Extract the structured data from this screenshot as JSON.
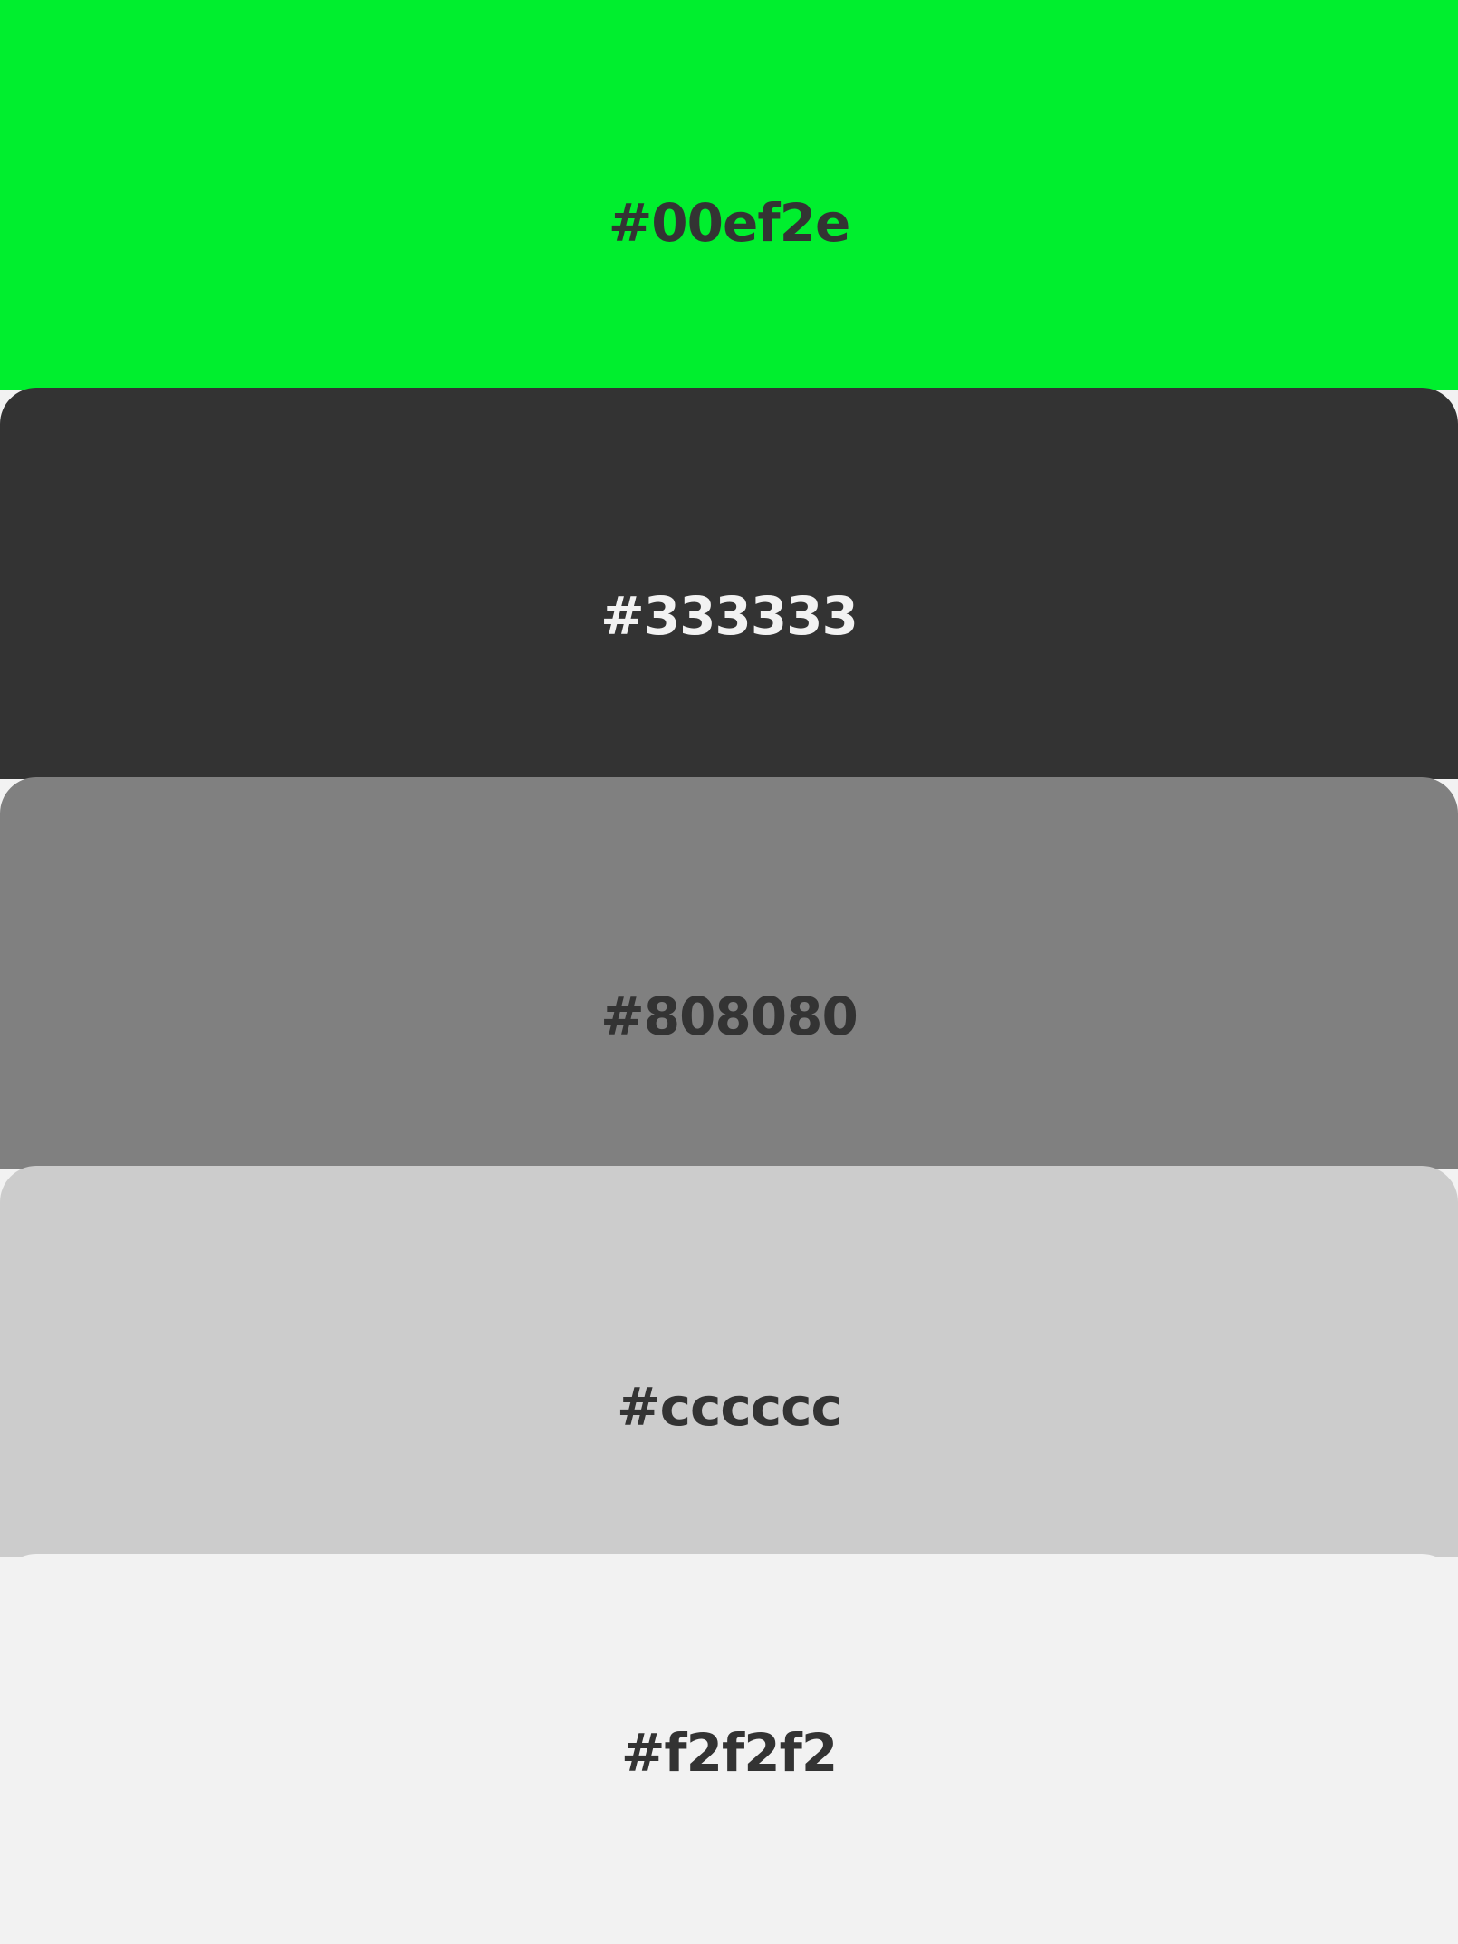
{
  "swatches": [
    {
      "label": "#00ef2e",
      "background": "#00ef2e",
      "text_color": "#333333"
    },
    {
      "label": "#333333",
      "background": "#333333",
      "text_color": "#f2f2f2"
    },
    {
      "label": "#808080",
      "background": "#808080",
      "text_color": "#333333"
    },
    {
      "label": "#cccccc",
      "background": "#cccccc",
      "text_color": "#333333"
    },
    {
      "label": "#f2f2f2",
      "background": "#f2f2f2",
      "text_color": "#333333"
    }
  ]
}
